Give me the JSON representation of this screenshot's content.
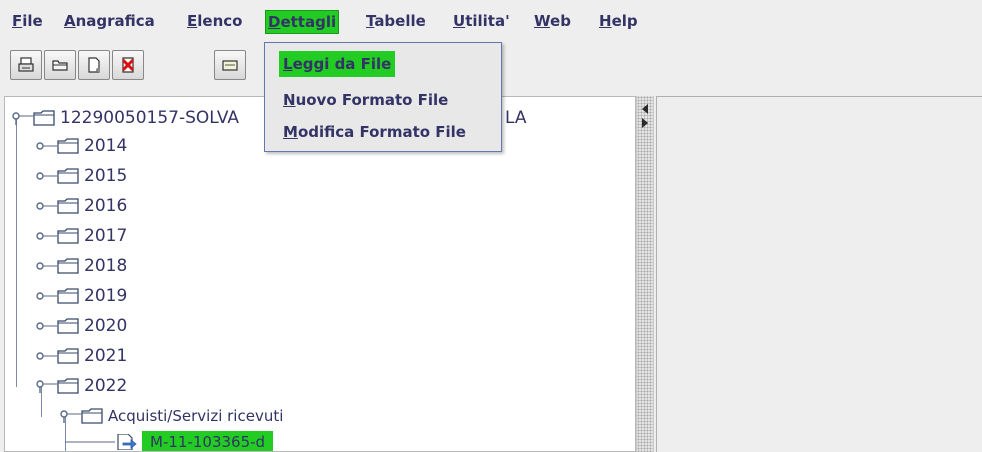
{
  "menubar": {
    "items": [
      {
        "mnemonic": "F",
        "rest": "ile"
      },
      {
        "mnemonic": "A",
        "rest": "nagrafica"
      },
      {
        "mnemonic": "E",
        "rest": "lenco"
      },
      {
        "mnemonic": "D",
        "rest": "ettagli"
      },
      {
        "mnemonic": "T",
        "rest": "abelle"
      },
      {
        "mnemonic": "U",
        "rest": "tilita'"
      },
      {
        "mnemonic": "W",
        "rest": "eb"
      },
      {
        "mnemonic": "H",
        "rest": "elp"
      }
    ],
    "active": "Dettagli"
  },
  "toolbar": {
    "buttons": [
      "print-icon",
      "open-folder-icon",
      "new-document-icon",
      "delete-icon",
      "card-icon"
    ]
  },
  "dropdown": {
    "items": [
      {
        "mnemonic": "L",
        "rest": "eggi da File"
      },
      {
        "mnemonic": "N",
        "rest": "uovo Formato File"
      },
      {
        "mnemonic": "M",
        "rest": "odifica Formato File"
      }
    ],
    "highlighted": "Leggi da File"
  },
  "tree": {
    "root": {
      "label_visible": "12290050157-SOLVA",
      "label_tail": "LA"
    },
    "years": [
      "2014",
      "2015",
      "2016",
      "2017",
      "2018",
      "2019",
      "2020",
      "2021",
      "2022"
    ],
    "subfolder": "Acquisti/Servizi ricevuti",
    "leaf": "M-11-103365-d"
  },
  "colors": {
    "highlight": "#22cc22",
    "text": "#333366",
    "background": "#eeeeee"
  }
}
